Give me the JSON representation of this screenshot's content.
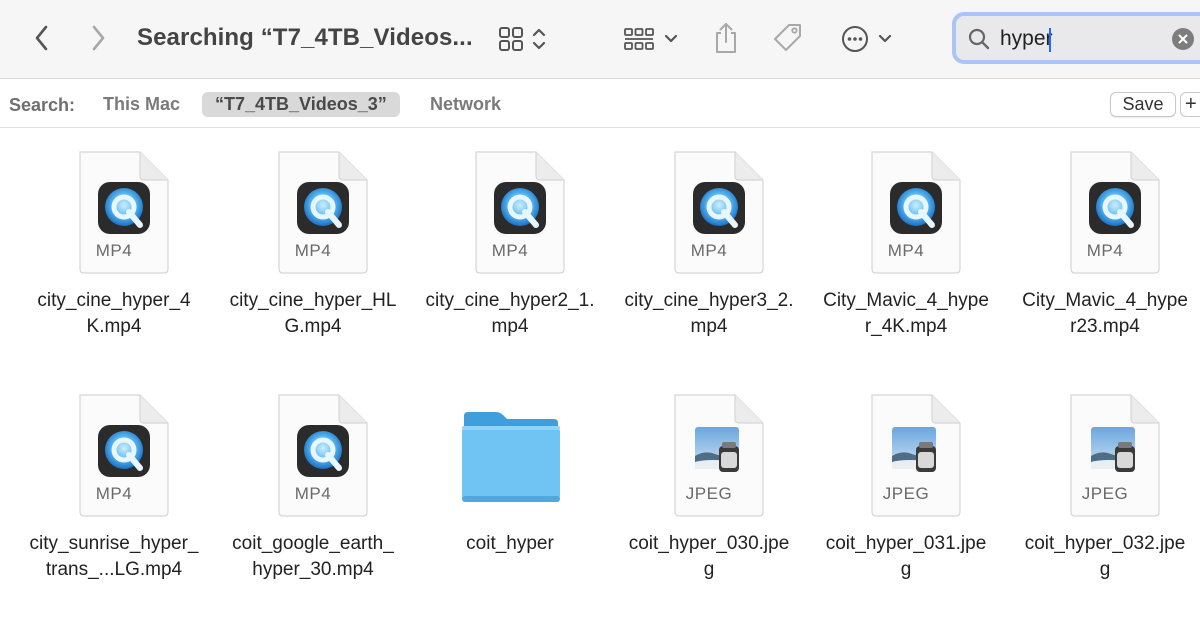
{
  "toolbar": {
    "title": "Searching “T7_4TB_Videos...",
    "back_icon": "chevron-left-icon",
    "forward_icon": "chevron-right-icon",
    "view_icon": "icon-grid-view-icon",
    "group_icon": "group-by-icon",
    "share_icon": "share-icon",
    "tag_icon": "tag-icon",
    "more_icon": "ellipsis-circle-icon"
  },
  "search": {
    "value": "hyper",
    "placeholder": "Search"
  },
  "scope": {
    "label": "Search:",
    "this_mac": "This Mac",
    "volume": "“T7_4TB_Videos_3”",
    "network": "Network",
    "save": "Save",
    "add": "+"
  },
  "files": [
    {
      "name": "city_cine_hyper_4K.mp4",
      "kind": "MP4"
    },
    {
      "name": "city_cine_hyper_HLG.mp4",
      "kind": "MP4"
    },
    {
      "name": "city_cine_hyper2_1.mp4",
      "kind": "MP4"
    },
    {
      "name": "city_cine_hyper3_2.mp4",
      "kind": "MP4"
    },
    {
      "name": "City_Mavic_4_hyper_4K.mp4",
      "kind": "MP4"
    },
    {
      "name": "City_Mavic_4_hyper23.mp4",
      "kind": "MP4"
    },
    {
      "name": "city_sunrise_hyper_trans_...LG.mp4",
      "kind": "MP4"
    },
    {
      "name": "coit_google_earth_hyper_30.mp4",
      "kind": "MP4"
    },
    {
      "name": "coit_hyper",
      "kind": "folder"
    },
    {
      "name": "coit_hyper_030.jpeg",
      "kind": "JPEG"
    },
    {
      "name": "coit_hyper_031.jpeg",
      "kind": "JPEG"
    },
    {
      "name": "coit_hyper_032.jpeg",
      "kind": "JPEG"
    }
  ],
  "colors": {
    "accent": "#1f6bff",
    "folder": "#5ab9f0",
    "search_ring": "#a9c4f5"
  }
}
